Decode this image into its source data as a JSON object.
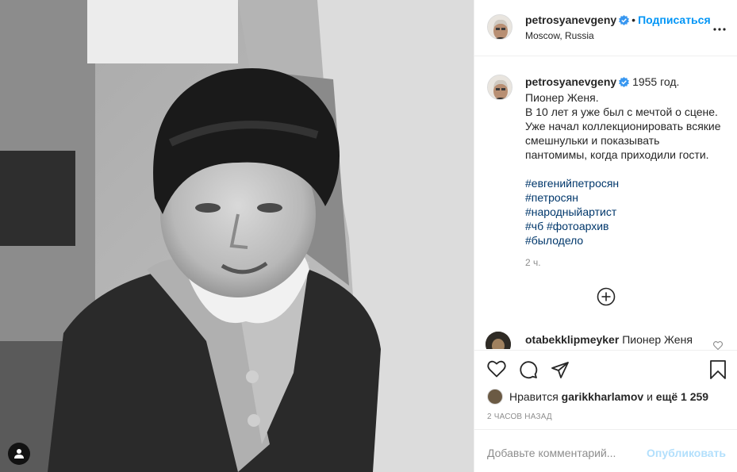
{
  "post": {
    "author": "petrosyanevgeny",
    "follow_label": "Подписаться",
    "dot": "•",
    "location": "Moscow, Russia",
    "caption_first": "1955 год.",
    "caption_body": "Пионер Женя.\nВ 10 лет я уже был с мечтой о сцене.\nУже начал коллекционировать всякие смешнульки и показывать пантомимы, когда приходили гости.",
    "hashtags": [
      "#евгенийпетросян",
      "#петросян",
      "#народныйартист",
      "#чб #фотоархив",
      "#былоделo"
    ],
    "time_short": "2 ч.",
    "comment": {
      "author": "otabekklipmeyker",
      "text": "Пионер Женя"
    },
    "likes": {
      "prefix": "Нравится",
      "user": "garikkharlamov",
      "conj": "и",
      "count_text": "ещё 1 259"
    },
    "time_ago": "2 часов назад",
    "comment_placeholder": "Добавьте комментарий...",
    "publish_label": "Опубликовать"
  },
  "colors": {
    "link": "#0095f6",
    "hashtag": "#00376b",
    "muted": "#8e8e8e",
    "publish_disabled": "#b2dffc"
  },
  "icons": [
    "user-tag-icon",
    "verified-badge-icon",
    "more-options-icon",
    "add-comment-icon",
    "heart-icon",
    "comment-icon",
    "share-icon",
    "bookmark-icon"
  ]
}
